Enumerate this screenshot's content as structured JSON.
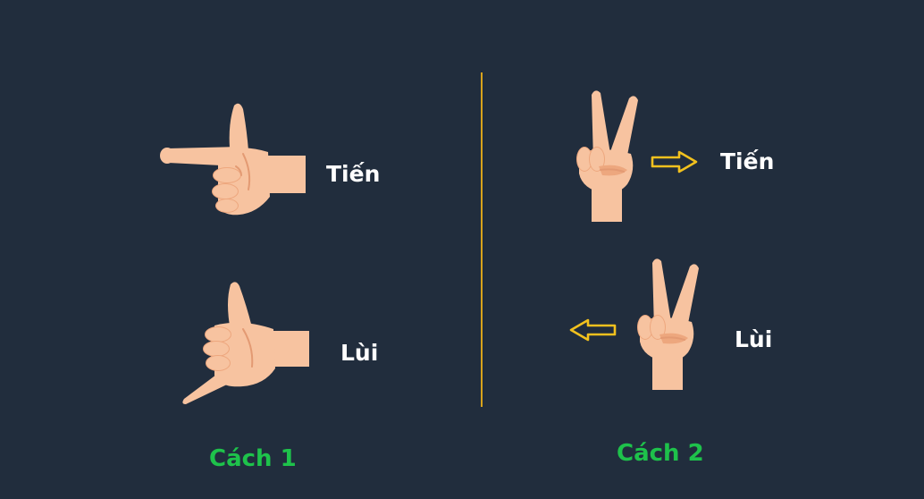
{
  "method1": {
    "caption": "Cách 1",
    "forward_label": "Tiến",
    "backward_label": "Lùi"
  },
  "method2": {
    "caption": "Cách 2",
    "forward_label": "Tiến",
    "backward_label": "Lùi"
  },
  "colors": {
    "background": "#212d3d",
    "label_text": "#ffffff",
    "caption_text": "#1ec24b",
    "divider": "#d8a31c",
    "arrow_outline": "#f2c11e",
    "skin": "#f7c3a0"
  }
}
